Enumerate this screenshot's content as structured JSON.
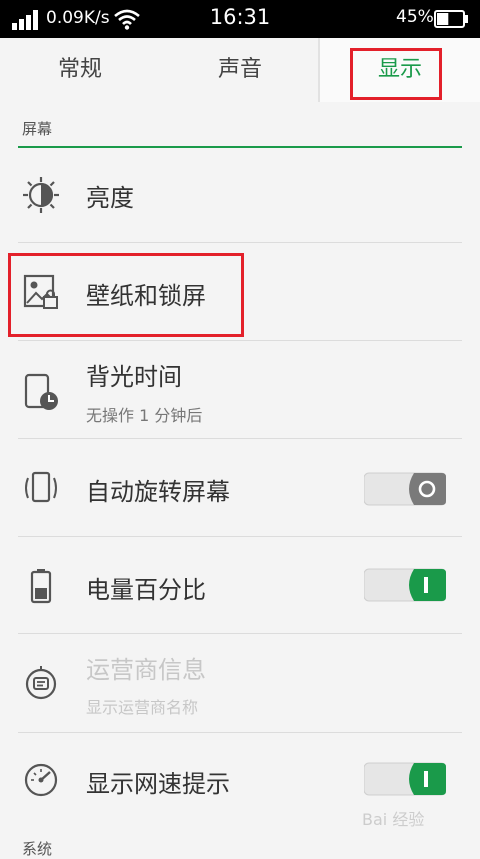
{
  "status_bar": {
    "network_speed": "0.09K/s",
    "time": "16:31",
    "battery_percent": "45%",
    "battery_level": 0.45,
    "icons": [
      "signal-icon",
      "wifi-icon",
      "battery-icon"
    ]
  },
  "tabs": [
    {
      "label": "常规",
      "selected": false
    },
    {
      "label": "声音",
      "selected": false
    },
    {
      "label": "显示",
      "selected": true
    }
  ],
  "section": {
    "label": "屏幕"
  },
  "settings": [
    {
      "title": "亮度",
      "icon": "brightness-icon"
    },
    {
      "title": "壁纸和锁屏",
      "icon": "wallpaper-lock-icon"
    },
    {
      "title": "背光时间",
      "subtitle": "无操作 1 分钟后",
      "icon": "backlight-timer-icon"
    },
    {
      "title": "自动旋转屏幕",
      "icon": "auto-rotate-icon",
      "toggle": false
    },
    {
      "title": "电量百分比",
      "icon": "battery-percent-icon",
      "toggle": true
    },
    {
      "title": "运营商信息",
      "subtitle": "显示运营商名称",
      "icon": "carrier-info-icon",
      "enabled": false
    },
    {
      "title": "显示网速提示",
      "icon": "speedometer-icon",
      "toggle": true
    }
  ],
  "next_section": {
    "label": "系统"
  },
  "watermark": "Bai 经验",
  "colors": {
    "accent": "#1a9a4a",
    "highlight": "#e3202a",
    "background": "#f4f4f4"
  }
}
